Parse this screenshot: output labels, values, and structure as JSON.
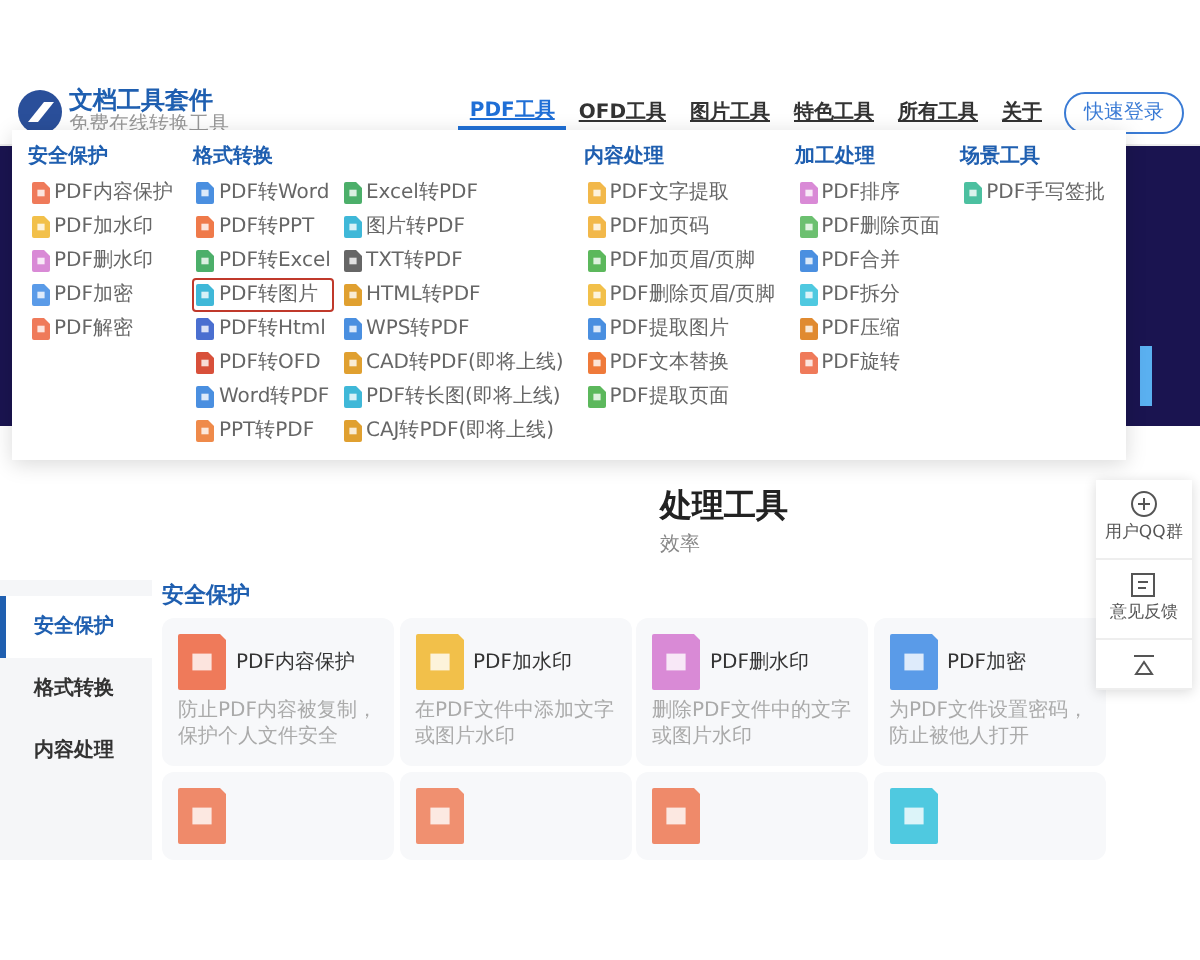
{
  "header": {
    "logo_title": "文档工具套件",
    "logo_subtitle": "免费在线转换工具",
    "nav": [
      {
        "label": "PDF工具",
        "selected": true
      },
      {
        "label": "OFD工具",
        "selected": false
      },
      {
        "label": "图片工具",
        "selected": false
      },
      {
        "label": "特色工具",
        "selected": false
      },
      {
        "label": "所有工具",
        "selected": false
      },
      {
        "label": "关于",
        "selected": false
      }
    ],
    "login_button": "快速登录"
  },
  "menu": {
    "groups": [
      {
        "title": "安全保护",
        "columns": [
          [
            {
              "label": "PDF内容保护",
              "color": "#ef7a5a",
              "selected": false
            },
            {
              "label": "PDF加水印",
              "color": "#f2c04a",
              "selected": false
            },
            {
              "label": "PDF删水印",
              "color": "#d98ad6",
              "selected": false
            },
            {
              "label": "PDF加密",
              "color": "#5a9be8",
              "selected": false
            },
            {
              "label": "PDF解密",
              "color": "#ef7a5a",
              "selected": false
            }
          ]
        ]
      },
      {
        "title": "格式转换",
        "columns": [
          [
            {
              "label": "PDF转Word",
              "color": "#4a8fe0",
              "selected": false
            },
            {
              "label": "PDF转PPT",
              "color": "#ef7a4a",
              "selected": false
            },
            {
              "label": "PDF转Excel",
              "color": "#4caf6a",
              "selected": false
            },
            {
              "label": "PDF转图片",
              "color": "#3fb8d8",
              "selected": true
            },
            {
              "label": "PDF转Html",
              "color": "#4a6fd0",
              "selected": false
            },
            {
              "label": "PDF转OFD",
              "color": "#d8503a",
              "selected": false
            },
            {
              "label": "Word转PDF",
              "color": "#4a8fe0",
              "selected": false
            },
            {
              "label": "PPT转PDF",
              "color": "#ef8a4a",
              "selected": false
            }
          ],
          [
            {
              "label": "Excel转PDF",
              "color": "#4caf6a",
              "selected": false
            },
            {
              "label": "图片转PDF",
              "color": "#3fb8d8",
              "selected": false
            },
            {
              "label": "TXT转PDF",
              "color": "#666666",
              "selected": false
            },
            {
              "label": "HTML转PDF",
              "color": "#e0a030",
              "selected": false
            },
            {
              "label": "WPS转PDF",
              "color": "#4a8fe0",
              "selected": false
            },
            {
              "label": "CAD转PDF(即将上线)",
              "color": "#e0a030",
              "selected": false
            },
            {
              "label": "PDF转长图(即将上线)",
              "color": "#3fb8d8",
              "selected": false
            },
            {
              "label": "CAJ转PDF(即将上线)",
              "color": "#e0a030",
              "selected": false
            }
          ]
        ]
      },
      {
        "title": "内容处理",
        "columns": [
          [
            {
              "label": "PDF文字提取",
              "color": "#f2b84a",
              "selected": false
            },
            {
              "label": "PDF加页码",
              "color": "#f2b84a",
              "selected": false
            },
            {
              "label": "PDF加页眉/页脚",
              "color": "#5cb85c",
              "selected": false
            },
            {
              "label": "PDF删除页眉/页脚",
              "color": "#f2c04a",
              "selected": false
            },
            {
              "label": "PDF提取图片",
              "color": "#4a8fe0",
              "selected": false
            },
            {
              "label": "PDF文本替换",
              "color": "#ef7a3a",
              "selected": false
            },
            {
              "label": "PDF提取页面",
              "color": "#5cb85c",
              "selected": false
            }
          ]
        ]
      },
      {
        "title": "加工处理",
        "columns": [
          [
            {
              "label": "PDF排序",
              "color": "#d98ad6",
              "selected": false
            },
            {
              "label": "PDF删除页面",
              "color": "#6cc070",
              "selected": false
            },
            {
              "label": "PDF合并",
              "color": "#4a8fe0",
              "selected": false
            },
            {
              "label": "PDF拆分",
              "color": "#4fc9e0",
              "selected": false
            },
            {
              "label": "PDF压缩",
              "color": "#e08a30",
              "selected": false
            },
            {
              "label": "PDF旋转",
              "color": "#ef7a5a",
              "selected": false
            }
          ]
        ]
      },
      {
        "title": "场景工具",
        "columns": [
          [
            {
              "label": "PDF手写签批",
              "color": "#4cc0a0",
              "selected": false
            }
          ]
        ]
      }
    ]
  },
  "hero": {
    "title": "处理工具",
    "subtitle": "效率"
  },
  "float_toolbar": [
    {
      "kind": "chat",
      "label": "用户QQ群"
    },
    {
      "kind": "feedback",
      "label": "意见反馈"
    },
    {
      "kind": "top"
    }
  ],
  "sidebar": [
    {
      "label": "安全保护",
      "selected": true
    },
    {
      "label": "格式转换",
      "selected": false
    },
    {
      "label": "内容处理",
      "selected": false
    }
  ],
  "section": {
    "title": "安全保护",
    "cards": [
      {
        "title": "PDF内容保护",
        "description": "防止PDF内容被复制，保护个人文件安全",
        "color": "#ef7a5a"
      },
      {
        "title": "PDF加水印",
        "description": "在PDF文件中添加文字或图片水印",
        "color": "#f2c04a"
      },
      {
        "title": "PDF删水印",
        "description": "删除PDF文件中的文字或图片水印",
        "color": "#d98ad6"
      },
      {
        "title": "PDF加密",
        "description": "为PDF文件设置密码，防止被他人打开",
        "color": "#5a9be8"
      },
      {
        "color": "#ef8a6a"
      },
      {
        "color": "#f09070"
      },
      {
        "color": "#ef8a6a"
      },
      {
        "color": "#4fc9e0"
      }
    ]
  }
}
